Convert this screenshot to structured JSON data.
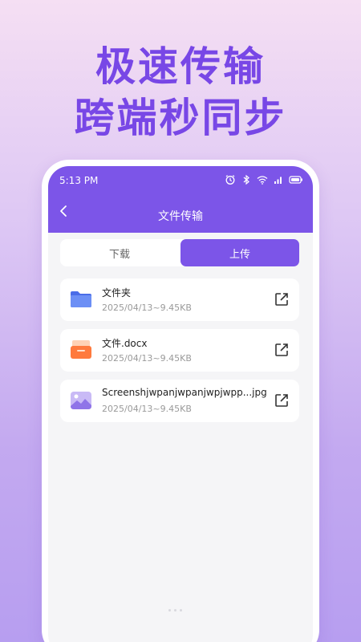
{
  "headline": {
    "line1": "极速传输",
    "line2": "跨端秒同步"
  },
  "status_bar": {
    "time": "5:13 PM",
    "icons": [
      "alarm-icon",
      "bluetooth-icon",
      "wifi-icon",
      "signal-icon",
      "battery-icon"
    ]
  },
  "header": {
    "title": "文件传输",
    "back_icon": "chevron-left-icon"
  },
  "tabs": [
    {
      "label": "下载",
      "active": false
    },
    {
      "label": "上传",
      "active": true
    }
  ],
  "files": [
    {
      "name": "文件夹",
      "meta": "2025/04/13~9.45KB",
      "icon": "folder-icon"
    },
    {
      "name": "文件.docx",
      "meta": "2025/04/13~9.45KB",
      "icon": "document-icon"
    },
    {
      "name": "Screenshjwpanjwpanjwpjwpp...jpg",
      "meta": "2025/04/13~9.45KB",
      "icon": "image-icon"
    }
  ],
  "colors": {
    "accent": "#7c55e8",
    "headline": "#7847e6",
    "folder_blue": "#5a7ef0",
    "doc_orange": "#ff7a3d",
    "image_lavender": "#b8a6f2"
  }
}
